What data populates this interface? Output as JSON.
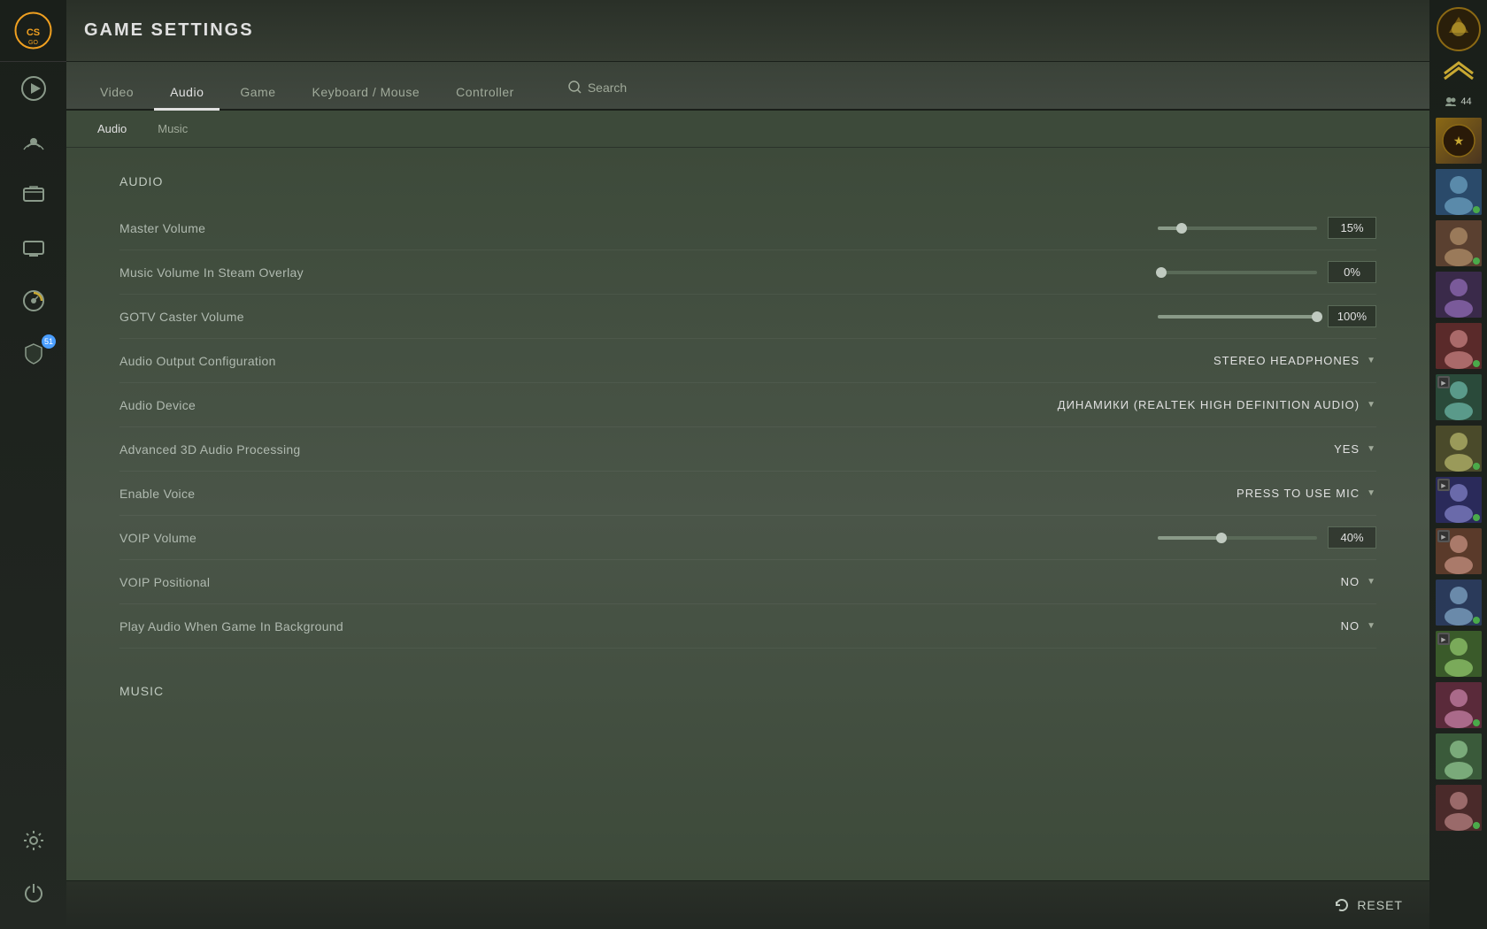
{
  "app": {
    "title": "GAME SETTINGS"
  },
  "nav": {
    "tabs": [
      {
        "id": "video",
        "label": "Video",
        "active": false
      },
      {
        "id": "audio",
        "label": "Audio",
        "active": true
      },
      {
        "id": "game",
        "label": "Game",
        "active": false
      },
      {
        "id": "keyboard_mouse",
        "label": "Keyboard / Mouse",
        "active": false
      },
      {
        "id": "controller",
        "label": "Controller",
        "active": false
      }
    ],
    "search_label": "Search"
  },
  "sub_tabs": [
    {
      "id": "audio",
      "label": "Audio",
      "active": true
    },
    {
      "id": "music",
      "label": "Music",
      "active": false
    }
  ],
  "sections": {
    "audio": {
      "title": "Audio",
      "settings": [
        {
          "id": "master_volume",
          "label": "Master Volume",
          "type": "slider",
          "value": "15%",
          "fill_percent": 15
        },
        {
          "id": "music_volume_overlay",
          "label": "Music Volume In Steam Overlay",
          "type": "slider",
          "value": "0%",
          "fill_percent": 0
        },
        {
          "id": "gotv_caster_volume",
          "label": "GOTV Caster Volume",
          "type": "slider",
          "value": "100%",
          "fill_percent": 100
        },
        {
          "id": "audio_output_config",
          "label": "Audio Output Configuration",
          "type": "dropdown",
          "value": "STEREO HEADPHONES"
        },
        {
          "id": "audio_device",
          "label": "Audio Device",
          "type": "dropdown",
          "value": "ДИНАМИКИ (REALTEK HIGH DEFINITION AUDIO)"
        },
        {
          "id": "advanced_3d_audio",
          "label": "Advanced 3D Audio Processing",
          "type": "dropdown",
          "value": "YES"
        },
        {
          "id": "enable_voice",
          "label": "Enable Voice",
          "type": "dropdown",
          "value": "PRESS TO USE MIC"
        },
        {
          "id": "voip_volume",
          "label": "VOIP Volume",
          "type": "slider",
          "value": "40%",
          "fill_percent": 40
        },
        {
          "id": "voip_positional",
          "label": "VOIP Positional",
          "type": "dropdown",
          "value": "NO"
        },
        {
          "id": "play_audio_background",
          "label": "Play Audio When Game In Background",
          "type": "dropdown",
          "value": "NO"
        }
      ]
    },
    "music": {
      "title": "Music"
    }
  },
  "bottom_bar": {
    "reset_label": "RESET"
  },
  "sidebar": {
    "icons": [
      {
        "id": "play",
        "symbol": "▶"
      },
      {
        "id": "broadcast",
        "symbol": "📡"
      },
      {
        "id": "inventory",
        "symbol": "🗂"
      },
      {
        "id": "tv",
        "symbol": "📺"
      },
      {
        "id": "stats",
        "symbol": "📊"
      },
      {
        "id": "shield",
        "symbol": "🛡",
        "badge": "51"
      },
      {
        "id": "settings",
        "symbol": "⚙"
      }
    ]
  },
  "right_panel": {
    "friends_count": "44",
    "avatars": [
      {
        "id": 1,
        "color": "#8b6914",
        "online": false
      },
      {
        "id": 2,
        "color": "#3a6b8a",
        "online": true
      },
      {
        "id": 3,
        "color": "#7a5a3a",
        "online": true
      },
      {
        "id": 4,
        "color": "#5a3a6a",
        "online": false
      },
      {
        "id": 5,
        "color": "#6a3a3a",
        "online": true
      },
      {
        "id": 6,
        "color": "#3a6a5a",
        "online": false
      },
      {
        "id": 7,
        "color": "#6a6a3a",
        "online": true
      },
      {
        "id": 8,
        "color": "#4a4a6a",
        "online": true
      },
      {
        "id": 9,
        "color": "#6a4a3a",
        "online": false
      },
      {
        "id": 10,
        "color": "#3a5a6a",
        "online": true
      },
      {
        "id": 11,
        "color": "#5a6a4a",
        "online": false
      },
      {
        "id": 12,
        "color": "#6a3a5a",
        "online": true
      },
      {
        "id": 13,
        "color": "#4a6a3a",
        "online": false
      }
    ]
  }
}
